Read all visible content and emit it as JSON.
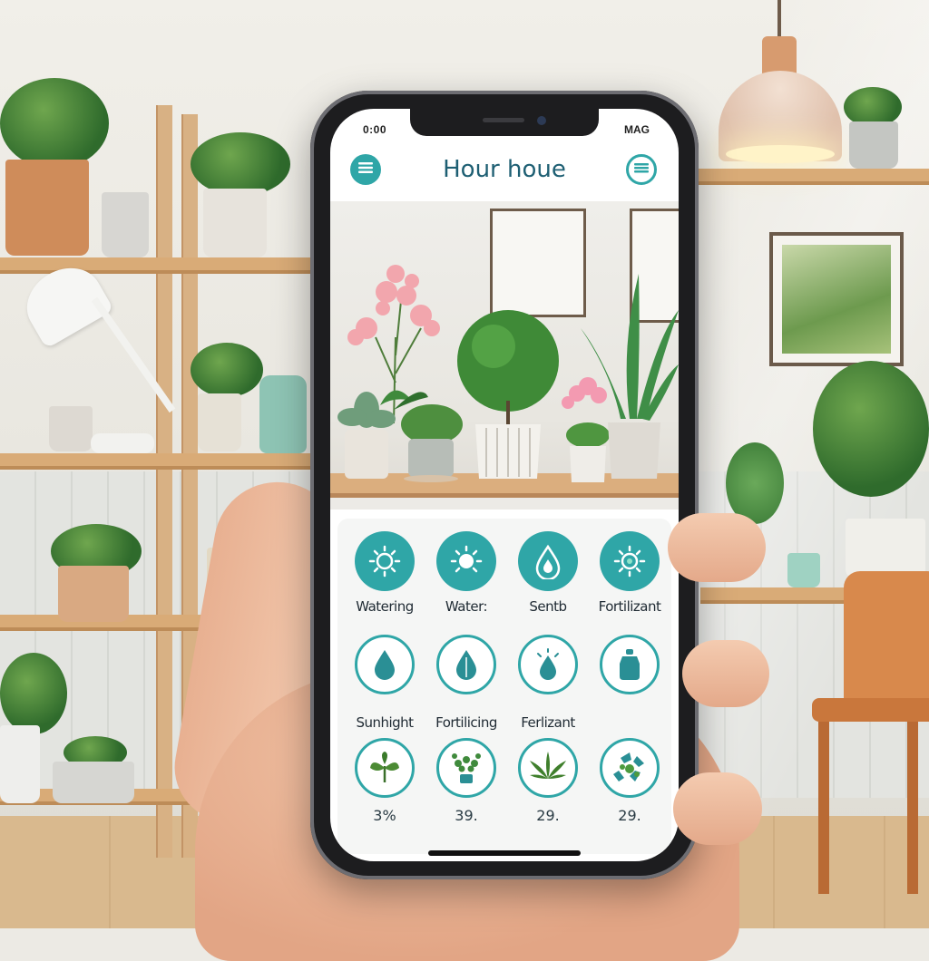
{
  "status_bar": {
    "left": "0:00",
    "right": "MAG"
  },
  "app": {
    "title": "Hour houe",
    "left_icon": "menu-icon",
    "right_icon": "menu-icon"
  },
  "hero_image": {
    "subject": "plants-on-shelf"
  },
  "features": {
    "row1": [
      {
        "label": "Watering",
        "icon": "sun-icon"
      },
      {
        "label": "Water:",
        "icon": "sun-icon"
      },
      {
        "label": "Sentb",
        "icon": "water-drop-icon"
      },
      {
        "label": "Fortilizant",
        "icon": "sun-icon"
      }
    ],
    "row2": [
      {
        "label": "Sunhight",
        "icon": "water-drop-icon"
      },
      {
        "label": "Fortilicing",
        "icon": "leaf-drop-icon"
      },
      {
        "label": "Ferlizant",
        "icon": "water-drop-icon"
      },
      {
        "label": "",
        "icon": "fertilizer-bottle-icon"
      }
    ],
    "row3": [
      {
        "percent": "3%",
        "icon": "plant-icon"
      },
      {
        "percent": "39.",
        "icon": "seedling-icon"
      },
      {
        "percent": "29.",
        "icon": "cannabis-leaf-icon"
      },
      {
        "percent": "29.",
        "icon": "recycle-leaves-icon"
      }
    ]
  },
  "colors": {
    "accent": "#2fa6a7",
    "title": "#1e5f73"
  }
}
